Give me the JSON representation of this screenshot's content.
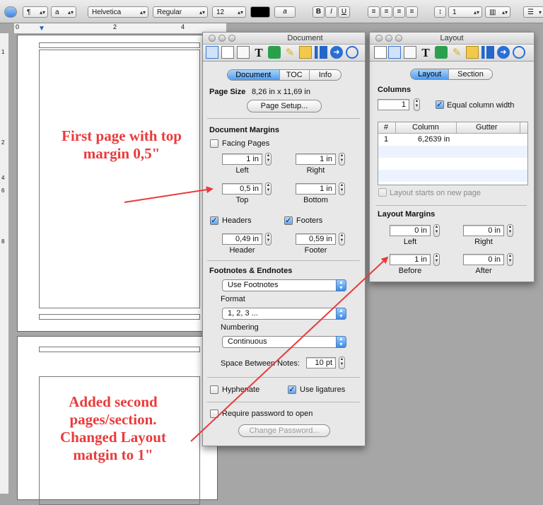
{
  "toolbar": {
    "style_popup": "¶",
    "char_popup": "a",
    "font_family": "Helvetica",
    "font_style": "Regular",
    "font_size": "12",
    "color_btn": "a",
    "bold": "B",
    "italic": "I",
    "underline": "U",
    "spacing": "1"
  },
  "ruler": {
    "marks": [
      "0",
      "2",
      "4"
    ]
  },
  "leftruler": {
    "marks": [
      "1",
      "2",
      "4",
      "6",
      "8"
    ]
  },
  "document_panel": {
    "title": "Document",
    "tabs": [
      "Document",
      "TOC",
      "Info"
    ],
    "page_size_label": "Page Size",
    "page_size_value": "8,26 in x 11,69 in",
    "page_setup_button": "Page Setup...",
    "margins_header": "Document Margins",
    "facing_pages": "Facing Pages",
    "left_value": "1 in",
    "left_label": "Left",
    "right_value": "1 in",
    "right_label": "Right",
    "top_value": "0,5 in",
    "top_label": "Top",
    "bottom_value": "1 in",
    "bottom_label": "Bottom",
    "headers_label": "Headers",
    "footers_label": "Footers",
    "header_value": "0,49 in",
    "header_label": "Header",
    "footer_value": "0,59 in",
    "footer_label": "Footer",
    "footnotes_header": "Footnotes & Endnotes",
    "footnotes_popup": "Use Footnotes",
    "format_label": "Format",
    "format_popup": "1, 2, 3 ...",
    "numbering_label": "Numbering",
    "numbering_popup": "Continuous",
    "space_label": "Space Between Notes:",
    "space_value": "10 pt",
    "hyphenate": "Hyphenate",
    "ligatures": "Use ligatures",
    "require_password": "Require password to open",
    "change_password": "Change Password..."
  },
  "layout_panel": {
    "title": "Layout",
    "tabs": [
      "Layout",
      "Section"
    ],
    "columns_header": "Columns",
    "columns_value": "1",
    "equal_width": "Equal column width",
    "table_headers": [
      "#",
      "Column",
      "Gutter"
    ],
    "table_row": [
      "1",
      "6,2639 in",
      ""
    ],
    "starts_new_page": "Layout starts on new page",
    "margins_header": "Layout Margins",
    "left_value": "0 in",
    "left_label": "Left",
    "right_value": "0 in",
    "right_label": "Right",
    "before_value": "1 in",
    "before_label": "Before",
    "after_value": "0 in",
    "after_label": "After"
  },
  "annotations": {
    "first": "First page with top margin 0,5\"",
    "second": "Added second pages/section. Changed Layout matgin to 1\""
  },
  "colors": {
    "annotation": "#ea3a3a",
    "selected_tab": "#5aa5f3"
  }
}
